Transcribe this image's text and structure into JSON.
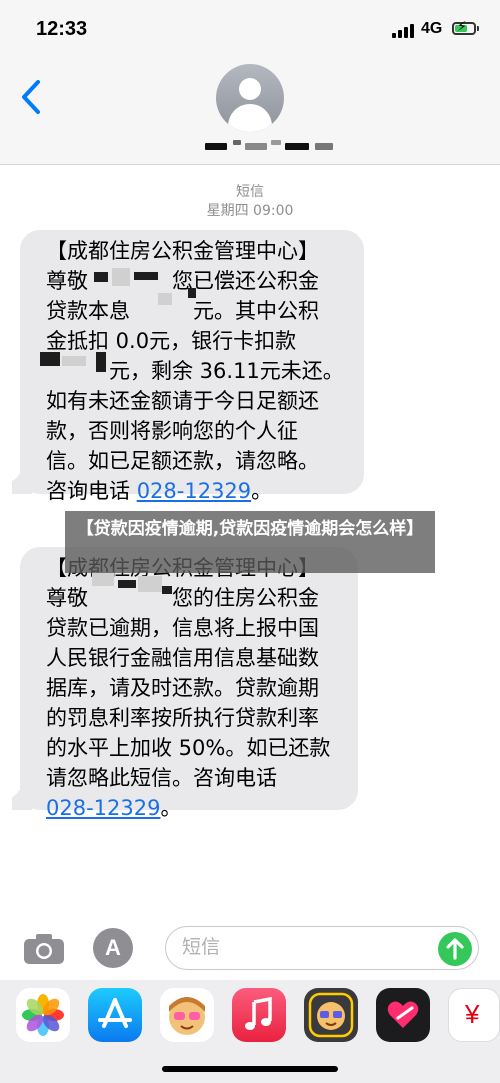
{
  "status_bar": {
    "time": "12:33",
    "network": "4G"
  },
  "header": {
    "back_icon": "chevron-left-icon"
  },
  "thread": {
    "type_label": "短信",
    "timestamp": "星期四 09:00"
  },
  "messages": [
    {
      "lines": [
        "【成都住房公积金管理中心】",
        "尊敬　　　　您已偿还公积金",
        "贷款本息　　　元。其中公积",
        "金抵扣 0.0元，银行卡扣款",
        "　　　元，剩余 36.11元未还。",
        "如有未还金额请于今日足额还",
        "款，否则将影响您的个人征",
        "信。如已足额还款，请忽略。"
      ],
      "last_line_prefix": "咨询电话 ",
      "phone": "028-12329",
      "last_line_suffix": "。"
    },
    {
      "lines": [
        "【成都住房公积金管理中心】",
        "尊敬　　　　您的住房公积金",
        "贷款已逾期，信息将上报中国",
        "人民银行金融信用信息基础数",
        "据库，请及时还款。贷款逾期",
        "的罚息利率按所执行贷款利率",
        "的水平上加收 50%。如已还款",
        "请忽略此短信。咨询电话"
      ],
      "last_line_prefix": "",
      "phone": "028-12329",
      "last_line_suffix": "。"
    }
  ],
  "caption": {
    "text": "【贷款因疫情逾期,贷款因疫情逾期会怎么样】"
  },
  "input_bar": {
    "placeholder": "短信",
    "camera_icon": "camera-icon",
    "apps_icon": "app-store-icon",
    "send_icon": "arrow-up-icon"
  },
  "app_drawer": {
    "apps": [
      "photos-icon",
      "app-store-icon",
      "memoji-icon",
      "music-icon",
      "memoji-sticker-icon",
      "digital-touch-icon",
      "cash-icon"
    ],
    "cash_symbol": "¥"
  },
  "colors": {
    "bubble_gray": "#e9e9eb",
    "link_blue": "#1a6fe6",
    "send_green": "#34c759",
    "back_blue": "#007aff"
  }
}
